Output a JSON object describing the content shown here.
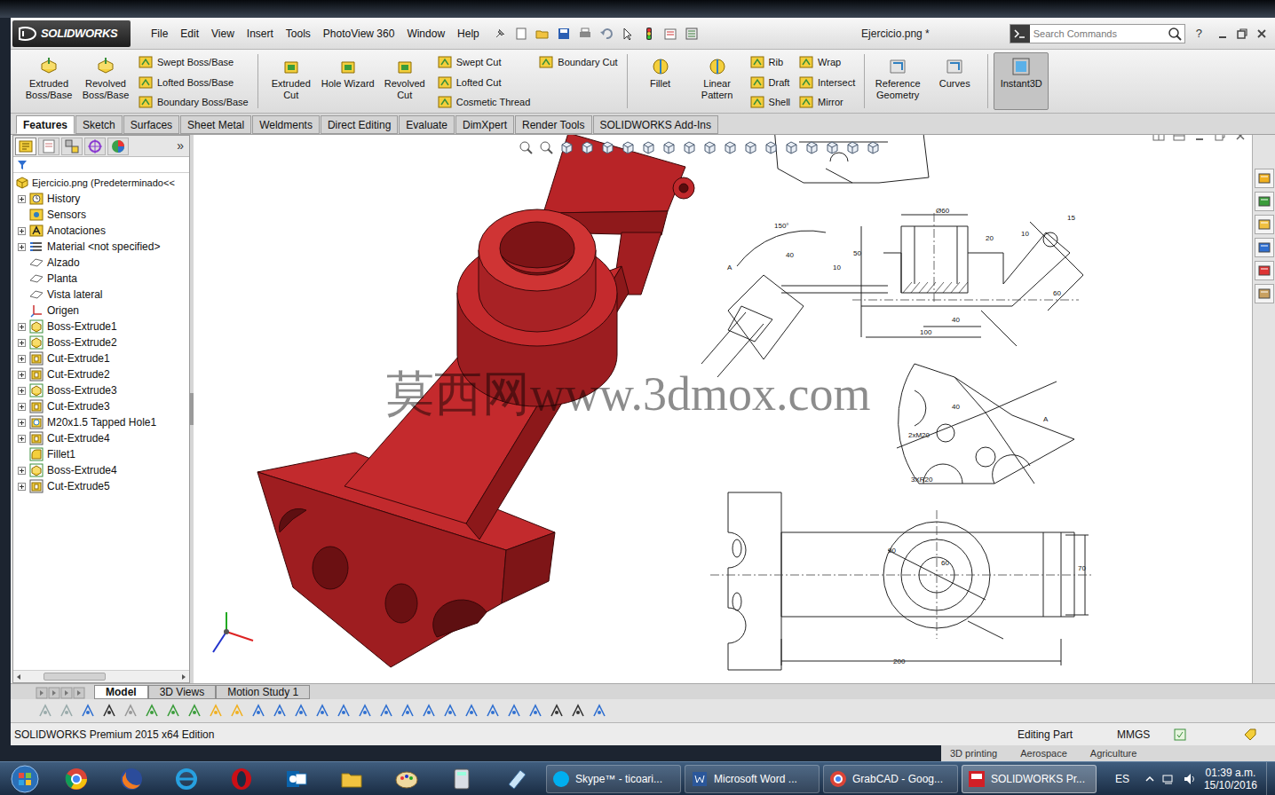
{
  "window": {
    "title": "Ejercicio.png *",
    "logo": "SOLIDWORKS"
  },
  "menu": [
    "File",
    "Edit",
    "View",
    "Insert",
    "Tools",
    "PhotoView 360",
    "Window",
    "Help"
  ],
  "search": {
    "placeholder": "Search Commands"
  },
  "help": "?",
  "command_groups": [
    [
      {
        "kind": "big",
        "label": "Extruded Boss/Base",
        "selected": false
      },
      {
        "kind": "big",
        "label": "Revolved Boss/Base",
        "selected": false
      },
      {
        "kind": "stack",
        "items": [
          "Swept Boss/Base",
          "Lofted Boss/Base",
          "Boundary Boss/Base"
        ]
      }
    ],
    [
      {
        "kind": "big",
        "label": "Extruded Cut",
        "selected": false
      },
      {
        "kind": "big",
        "label": "Hole Wizard",
        "selected": false
      },
      {
        "kind": "big",
        "label": "Revolved Cut",
        "selected": false
      },
      {
        "kind": "stack",
        "items": [
          "Swept Cut",
          "Lofted Cut",
          "Cosmetic Thread"
        ]
      },
      {
        "kind": "stack",
        "items": [
          "Boundary Cut"
        ]
      }
    ],
    [
      {
        "kind": "big",
        "label": "Fillet",
        "selected": false
      },
      {
        "kind": "big",
        "label": "Linear Pattern",
        "selected": false
      },
      {
        "kind": "stack",
        "items": [
          "Rib",
          "Draft",
          "Shell"
        ]
      },
      {
        "kind": "stack",
        "items": [
          "Wrap",
          "Intersect",
          "Mirror"
        ]
      }
    ],
    [
      {
        "kind": "big",
        "label": "Reference Geometry",
        "selected": false
      },
      {
        "kind": "big",
        "label": "Curves",
        "selected": false
      }
    ],
    [
      {
        "kind": "big",
        "label": "Instant3D",
        "selected": true
      }
    ]
  ],
  "tabs": [
    {
      "label": "Features",
      "selected": true
    },
    {
      "label": "Sketch",
      "selected": false
    },
    {
      "label": "Surfaces",
      "selected": false
    },
    {
      "label": "Sheet Metal",
      "selected": false
    },
    {
      "label": "Weldments",
      "selected": false
    },
    {
      "label": "Direct Editing",
      "selected": false
    },
    {
      "label": "Evaluate",
      "selected": false
    },
    {
      "label": "DimXpert",
      "selected": false
    },
    {
      "label": "Render Tools",
      "selected": false
    },
    {
      "label": "SOLIDWORKS Add-Ins",
      "selected": false
    }
  ],
  "tree": {
    "more": "»",
    "root": "Ejercicio.png (Predeterminado<<",
    "items": [
      {
        "label": "History",
        "kind": "history",
        "expandable": true,
        "expanded": false
      },
      {
        "label": "Sensors",
        "kind": "sensor",
        "expandable": false,
        "expanded": false
      },
      {
        "label": "Anotaciones",
        "kind": "annotation",
        "expandable": true,
        "expanded": false
      },
      {
        "label": "Material <not specified>",
        "kind": "material",
        "expandable": true,
        "expanded": false
      },
      {
        "label": "Alzado",
        "kind": "plane",
        "expandable": false,
        "expanded": false
      },
      {
        "label": "Planta",
        "kind": "plane",
        "expandable": false,
        "expanded": false
      },
      {
        "label": "Vista lateral",
        "kind": "plane",
        "expandable": false,
        "expanded": false
      },
      {
        "label": "Origen",
        "kind": "origin",
        "expandable": false,
        "expanded": false
      },
      {
        "label": "Boss-Extrude1",
        "kind": "boss",
        "expandable": true,
        "expanded": false
      },
      {
        "label": "Boss-Extrude2",
        "kind": "boss",
        "expandable": true,
        "expanded": false
      },
      {
        "label": "Cut-Extrude1",
        "kind": "cut",
        "expandable": true,
        "expanded": false
      },
      {
        "label": "Cut-Extrude2",
        "kind": "cut",
        "expandable": true,
        "expanded": false
      },
      {
        "label": "Boss-Extrude3",
        "kind": "boss",
        "expandable": true,
        "expanded": false
      },
      {
        "label": "Cut-Extrude3",
        "kind": "cut",
        "expandable": true,
        "expanded": false
      },
      {
        "label": "M20x1.5 Tapped Hole1",
        "kind": "hole",
        "expandable": true,
        "expanded": false
      },
      {
        "label": "Cut-Extrude4",
        "kind": "cut",
        "expandable": true,
        "expanded": false
      },
      {
        "label": "Fillet1",
        "kind": "fillet",
        "expandable": false,
        "expanded": false
      },
      {
        "label": "Boss-Extrude4",
        "kind": "boss",
        "expandable": true,
        "expanded": false
      },
      {
        "label": "Cut-Extrude5",
        "kind": "cut",
        "expandable": true,
        "expanded": false
      }
    ]
  },
  "drawing": {
    "watermark": "莫西网www.3dmox.com",
    "dimensions": [
      "150°",
      "Ø60",
      "A",
      "40",
      "10",
      "50",
      "20",
      "10",
      "15",
      "60",
      "40",
      "100",
      "40",
      "A",
      "2xM20",
      "3XR20",
      "90",
      "60",
      "70",
      "200"
    ]
  },
  "model_tabs": [
    {
      "label": "Model",
      "selected": true
    },
    {
      "label": "3D Views",
      "selected": false
    },
    {
      "label": "Motion Study 1",
      "selected": false
    }
  ],
  "status_bar": {
    "edition": "SOLIDWORKS Premium 2015 x64 Edition",
    "mode": "Editing Part",
    "units": "MMGS"
  },
  "behind_window": [
    "3D printing",
    "Aerospace",
    "Agriculture"
  ],
  "taskbar": {
    "tasks": [
      {
        "label": "Skype™ - ticoari...",
        "selected": false
      },
      {
        "label": "Microsoft Word ...",
        "selected": false
      },
      {
        "label": "GrabCAD - Goog...",
        "selected": false
      },
      {
        "label": "SOLIDWORKS Pr...",
        "selected": true
      }
    ],
    "language": "ES",
    "time": "01:39 a.m.",
    "date": "15/10/2016"
  }
}
